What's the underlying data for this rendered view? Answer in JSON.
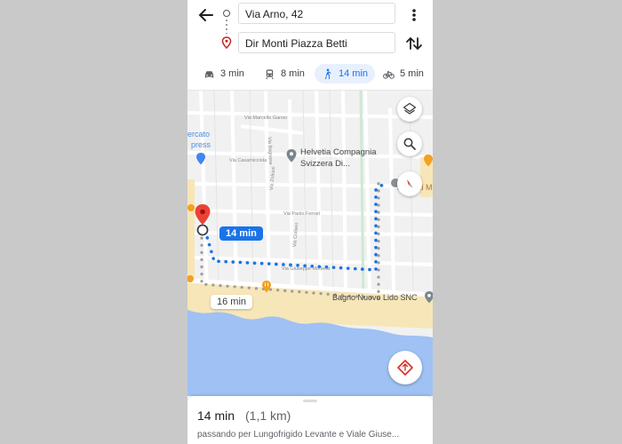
{
  "header": {
    "origin_value": "Via Arno, 42",
    "destination_value": "Dir Monti Piazza Betti"
  },
  "modes": [
    {
      "name": "car",
      "label": "3 min",
      "icon": "car-icon"
    },
    {
      "name": "transit",
      "label": "8 min",
      "icon": "train-icon"
    },
    {
      "name": "walk",
      "label": "14 min",
      "icon": "walk-icon",
      "selected": true
    },
    {
      "name": "bike",
      "label": "5 min",
      "icon": "bike-icon"
    }
  ],
  "map": {
    "place_labels": [
      {
        "id": "cercato",
        "text": "ercato"
      },
      {
        "id": "express",
        "text": "press"
      },
      {
        "id": "helvetia-1",
        "text": "Helvetia Compagnia"
      },
      {
        "id": "helvetia-2",
        "text": "Svizzera Di..."
      },
      {
        "id": "marinai",
        "text": "Marinai M"
      },
      {
        "id": "bagno",
        "text": "Bagno Nuovo Lido SNC"
      }
    ],
    "street_labels": [
      {
        "id": "marcello",
        "text": "Via Marcello Garosi"
      },
      {
        "id": "casamicciola",
        "text": "Via Casamicciola"
      },
      {
        "id": "bagnone",
        "text": "Via Bagnone"
      },
      {
        "id": "zolezzi",
        "text": "Via Zolezzi"
      },
      {
        "id": "ferrari",
        "text": "Via Paolo Ferrari"
      },
      {
        "id": "coliseo",
        "text": "Via Coliseo"
      },
      {
        "id": "modena",
        "text": "Via Giuseppe Modena"
      }
    ],
    "chips": {
      "primary": "14 min",
      "secondary": "16 min"
    }
  },
  "sheet": {
    "duration": "14 min",
    "distance": "(1,1 km)",
    "via": "passando per Lungofrigido Levante e Viale Giuse..."
  },
  "colors": {
    "accent": "#1a73e8",
    "route_primary": "#1a73e8",
    "route_alt": "#9e9e9e",
    "sea": "#9fc1f4",
    "sand": "#f7e6b7",
    "pin": "#ea4335",
    "poi": "#f4a020"
  }
}
